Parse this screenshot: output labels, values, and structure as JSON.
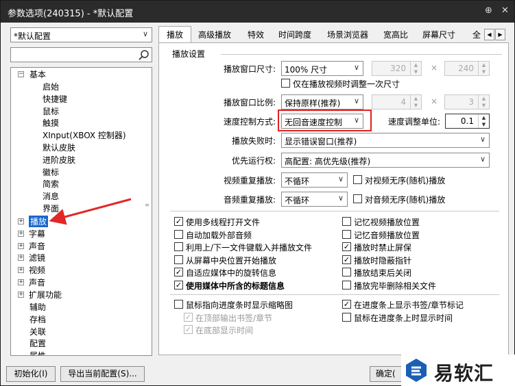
{
  "window": {
    "title": "参数选项(240315) - *默认配置"
  },
  "profile": {
    "value": "*默认配置"
  },
  "search": {
    "value": ""
  },
  "tree": {
    "basic": "基本",
    "basic_children": [
      "启始",
      "快捷键",
      "鼠标",
      "触摸",
      "XInput(XBOX 控制器)",
      "默认皮肤",
      "进阶皮肤",
      "徽标",
      "简索",
      "消息",
      "界面"
    ],
    "groups": [
      "播放",
      "字幕",
      "声音",
      "滤镜",
      "视频",
      "声音",
      "扩展功能"
    ],
    "leaves": [
      "辅助",
      "存档",
      "关联",
      "配置",
      "属性"
    ]
  },
  "tabs": [
    "播放",
    "高级播放",
    "特效",
    "时间跨度",
    "场景浏览器",
    "宽高比",
    "屏幕尺寸",
    "全"
  ],
  "settings": {
    "section": "播放设置",
    "win_size_label": "播放窗口尺寸:",
    "win_size_value": "100% 尺寸",
    "win_w": "320",
    "win_h": "240",
    "times": "×",
    "only_once": "仅在播放视频时调整一次尺寸",
    "ratio_label": "播放窗口比例:",
    "ratio_value": "保持原样(推荐)",
    "ratio_a": "4",
    "ratio_b": "3",
    "speed_label": "速度控制方式:",
    "speed_value": "无回音速度控制",
    "unit_label": "速度调整单位:",
    "unit_value": "0.1",
    "fail_label": "播放失败时:",
    "fail_value": "显示错误窗口(推荐)",
    "prio_label": "优先运行权:",
    "prio_value": "高配置: 高优先级(推荐)",
    "vrep_label": "视频重复播放:",
    "vrep_value": "不循环",
    "vrand": "对视频无序(随机)播放",
    "arep_label": "音频重复播放:",
    "arep_value": "不循环",
    "arand": "对音频无序(随机)播放"
  },
  "checks_left": [
    {
      "label": "使用多线程打开文件",
      "checked": "✓"
    },
    {
      "label": "自动加载外部音频",
      "checked": ""
    },
    {
      "label": "利用上/下一文件键载入并播放文件",
      "checked": ""
    },
    {
      "label": "从屏幕中央位置开始播放",
      "checked": ""
    },
    {
      "label": "自适应媒体中的旋转信息",
      "checked": "✓"
    },
    {
      "label": "使用媒体中所含的标题信息",
      "checked": "✓"
    }
  ],
  "checks_right": [
    {
      "label": "记忆视频播放位置",
      "checked": ""
    },
    {
      "label": "记忆音频播放位置",
      "checked": ""
    },
    {
      "label": "播放时禁止屏保",
      "checked": "✓"
    },
    {
      "label": "播放时隐蔽指针",
      "checked": "✓"
    },
    {
      "label": "播放结束后关闭",
      "checked": ""
    },
    {
      "label": "播放完毕删除相关文件",
      "checked": ""
    }
  ],
  "thumb": {
    "hover": "鼠标指向进度条时显示缩略图",
    "top": "在顶部输出书签/章节",
    "bottom": "在底部显示时间",
    "mark": "在进度条上显示书签/章节标记",
    "time": "鼠标在进度条上时显示时间",
    "check": "✓"
  },
  "buttons": {
    "init": "初始化(I)",
    "export": "导出当前配置(S)...",
    "ok": "确定("
  },
  "watermark": {
    "text": "易软汇"
  },
  "colors": {
    "highlight": "#e02020",
    "selected": "#1a66cc",
    "arrow": "#e02828"
  }
}
